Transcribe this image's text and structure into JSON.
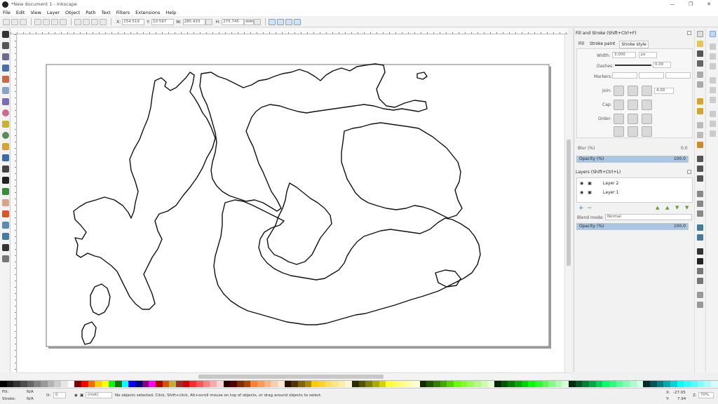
{
  "window": {
    "title": "*New document 1 - Inkscape",
    "controls": [
      "—",
      "❒",
      "✕"
    ]
  },
  "menu": [
    "File",
    "Edit",
    "View",
    "Layer",
    "Object",
    "Path",
    "Text",
    "Filters",
    "Extensions",
    "Help"
  ],
  "tool_controls": {
    "x_label": "X:",
    "x_value": "154.519",
    "y_label": "Y:",
    "y_value": "10.597",
    "w_label": "W:",
    "w_value": "285.433",
    "h_label": "H:",
    "h_value": "275.745",
    "unit": "mm"
  },
  "fill_stroke": {
    "title": "Fill and Stroke (Shift+Ctrl+F)",
    "tabs": [
      "Fill",
      "Stroke paint",
      "Stroke style"
    ],
    "width_label": "Width:",
    "width_value": "3.000",
    "width_unit": "px",
    "dashes_label": "Dashes:",
    "dashes_value": "0.00",
    "markers_label": "Markers:",
    "join_label": "Join:",
    "join_value": "4.00",
    "cap_label": "Cap:",
    "order_label": "Order:",
    "blur_label": "Blur (%)",
    "blur_value": "0.0",
    "opacity_label": "Opacity (%)",
    "opacity_value": "100.0",
    "opacity_fraction": 1.0
  },
  "layers": {
    "title": "Layers (Shift+Ctrl+L)",
    "items": [
      "Layer 2",
      "Layer 1"
    ],
    "blend_label": "Blend mode:",
    "blend_value": "Normal",
    "opacity_label": "Opacity (%)",
    "opacity_value": "100.0"
  },
  "status": {
    "fill_label": "Fill:",
    "fill_value": "N/A",
    "stroke_label": "Stroke:",
    "stroke_value": "N/A",
    "o_label": "O:",
    "o_value": "0",
    "layer_value": "(root)",
    "message": "No objects selected. Click, Shift+click, Alt+scroll mouse on top of objects, or drag around objects to select.",
    "x_label": "X:",
    "x_value": "-27.05",
    "y_label": "Y:",
    "y_value": "7.94",
    "zoom_label": "Z:",
    "zoom_value": "70%"
  },
  "colors": {
    "accent": "#3b78c4",
    "selected_tab": "#cfe3f5",
    "opacity_fill": "#a8c7e6",
    "palette": [
      "#000000",
      "#1a1a1a",
      "#333333",
      "#4d4d4d",
      "#666666",
      "#808080",
      "#999999",
      "#b3b3b3",
      "#cccccc",
      "#e6e6e6",
      "#ffffff",
      "#800000",
      "#ff0000",
      "#ff6600",
      "#ffcc00",
      "#ffff00",
      "#00ff00",
      "#008000",
      "#00ffff",
      "#0000ff",
      "#000080",
      "#800080",
      "#ff00ff",
      "#b30000",
      "#d45500",
      "#c8ab37",
      "#a02c2c",
      "#d40000",
      "#ff2a2a",
      "#ff5555",
      "#ff8080",
      "#ffaaaa",
      "#ffd5d5",
      "#2b0000",
      "#550000",
      "#802b00",
      "#aa4400",
      "#ff7f2a",
      "#ff9955",
      "#ffb380",
      "#ffccaa",
      "#ffe6d5",
      "#2b1100",
      "#553300",
      "#806600",
      "#aa8800",
      "#ffcc00",
      "#ffd42a",
      "#ffdd55",
      "#ffe680",
      "#ffeeaa",
      "#fff6d5",
      "#2b2b00",
      "#555500",
      "#808000",
      "#aaaa00",
      "#d4d400",
      "#ffff2a",
      "#ffff55",
      "#ffff80",
      "#ffffaa",
      "#ffffd5",
      "#112b00",
      "#225500",
      "#338000",
      "#44aa00",
      "#55d400",
      "#66ff00",
      "#7fff2a",
      "#99ff55",
      "#b3ff80",
      "#ccffaa",
      "#e5ffd5",
      "#002b00",
      "#005500",
      "#008000",
      "#00aa00",
      "#00d400",
      "#00ff00",
      "#2aff2a",
      "#55ff55",
      "#80ff80",
      "#aaffaa",
      "#d5ffd5",
      "#002b11",
      "#005522",
      "#008033",
      "#00aa44",
      "#00d455",
      "#00ff66",
      "#2aff80",
      "#55ff99",
      "#80ffb3",
      "#aaffcc",
      "#d5ffe6",
      "#002b2b",
      "#005555",
      "#008080",
      "#00aaaa",
      "#00d4d4",
      "#00ffff",
      "#2affff",
      "#55ffff",
      "#80ffff",
      "#aaffff",
      "#d5ffff"
    ]
  }
}
